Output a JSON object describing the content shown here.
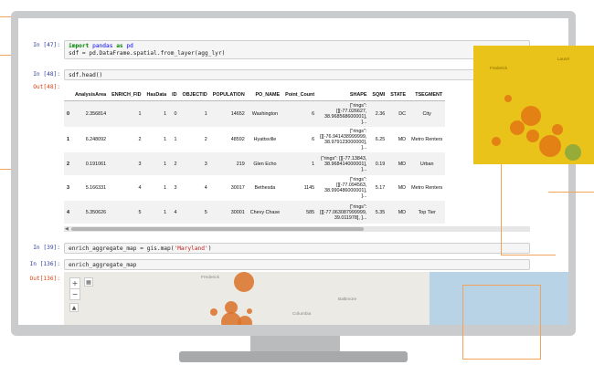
{
  "cells": [
    {
      "prompt": "In [47]:",
      "lines": [
        [
          {
            "t": "import",
            "c": "kw"
          },
          {
            "t": " "
          },
          {
            "t": "pandas",
            "c": "mod"
          },
          {
            "t": " "
          },
          {
            "t": "as",
            "c": "kw"
          },
          {
            "t": " "
          },
          {
            "t": "pd",
            "c": "mod"
          }
        ],
        [
          {
            "t": "sdf = pd.DataFrame.spatial.from_layer(agg_lyr)"
          }
        ]
      ]
    },
    {
      "prompt": "In [48]:",
      "lines": [
        [
          {
            "t": "sdf.head()"
          }
        ]
      ]
    },
    {
      "prompt": "In [39]:",
      "lines": [
        [
          {
            "t": "enrich_aggregate_map = gis.map("
          },
          {
            "t": "'Maryland'",
            "c": "str"
          },
          {
            "t": ")"
          }
        ]
      ]
    },
    {
      "prompt": "In [136]:",
      "lines": [
        [
          {
            "t": "enrich_aggregate_map"
          }
        ]
      ]
    }
  ],
  "out_prompts": {
    "table": "Out[48]:",
    "map": "Out[136]:"
  },
  "table": {
    "columns": [
      "",
      "AnalysisArea",
      "ENRICH_FID",
      "HasData",
      "ID",
      "OBJECTID",
      "POPULATION",
      "PO_NAME",
      "Point_Count",
      "SHAPE",
      "SQMI",
      "STATE",
      "TSEGMENT"
    ],
    "rows": [
      [
        "0",
        "2.356814",
        "1",
        "1",
        "0",
        "1",
        "14652",
        "Washington",
        "6",
        "{\"rings\": [[[-77.026627, 38.968568600001], ]...",
        "2.36",
        "DC",
        "City"
      ],
      [
        "1",
        "6.248092",
        "2",
        "1",
        "1",
        "2",
        "48592",
        "Hyattsville",
        "6",
        "{\"rings\": [[[-76.941438999999, 38.979123000000], ]...",
        "6.25",
        "MD",
        "Metro Renters"
      ],
      [
        "2",
        "0.191061",
        "3",
        "1",
        "2",
        "3",
        "219",
        "Glen Echo",
        "1",
        "{\"rings\": [[[-77.13843, 38.968414000001], ]...",
        "0.19",
        "MD",
        "Urban"
      ],
      [
        "3",
        "5.166331",
        "4",
        "1",
        "3",
        "4",
        "30017",
        "Bethesda",
        "1145",
        "{\"rings\": [[[-77.094563, 38.990486000001], ]...",
        "5.17",
        "MD",
        "Metro Renters"
      ],
      [
        "4",
        "5.350626",
        "5",
        "1",
        "4",
        "5",
        "30001",
        "Chevy Chase",
        "585",
        "{\"rings\": [[[-77.063087999999, 39.011978], ]...",
        "5.35",
        "MD",
        "Top Tier"
      ]
    ]
  },
  "map": {
    "labels": [
      "Frederick",
      "Baltimore",
      "Columbia"
    ],
    "zoom_in": "+",
    "zoom_out": "−",
    "tools": [
      "layers-icon",
      "compass-icon"
    ]
  },
  "inset": {
    "labels": [
      "Frederick",
      "Laurel"
    ]
  },
  "colors": {
    "accent": "#f0a35b",
    "bubble": "#da7228",
    "inset_bg": "#e9c21a"
  }
}
